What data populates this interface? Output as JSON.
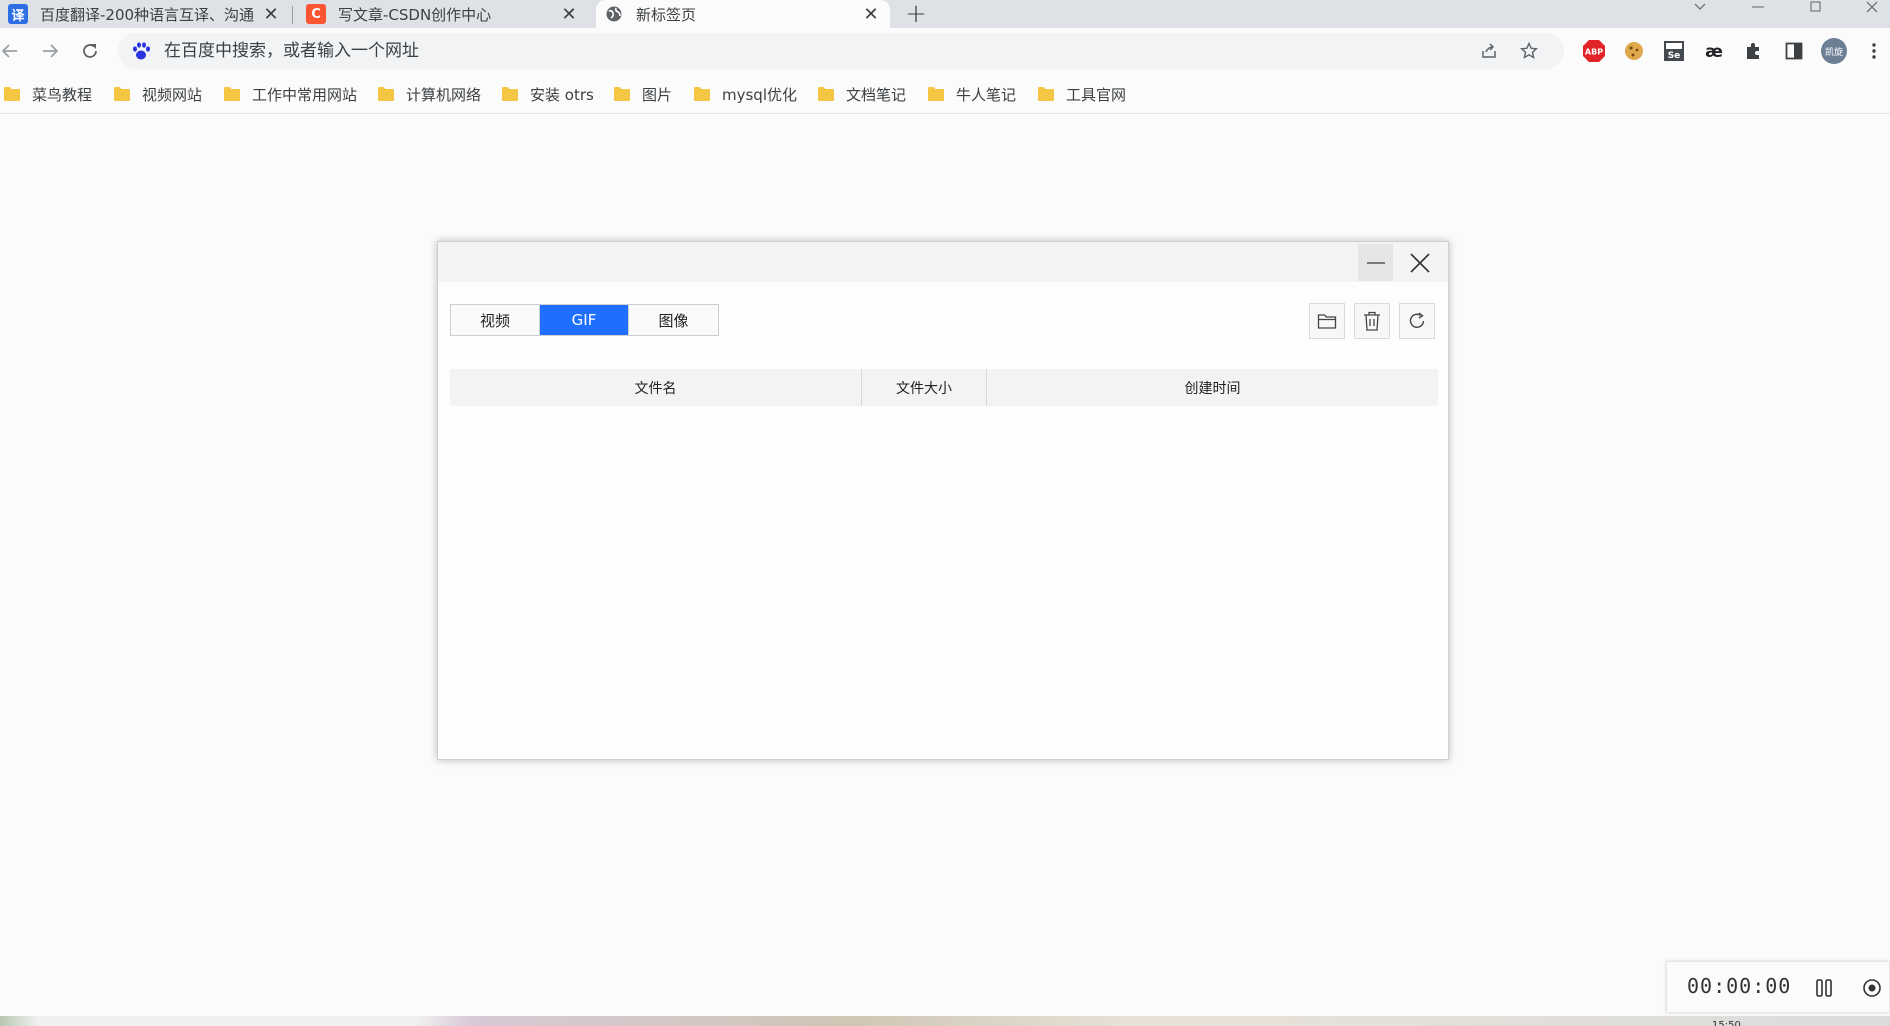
{
  "browser": {
    "tabs": [
      {
        "title": "百度翻译-200种语言互译、沟通",
        "favicon_text": "译",
        "favicon_color": "#2d6ee6",
        "active": false
      },
      {
        "title": "写文章-CSDN创作中心",
        "favicon_text": "C",
        "favicon_color": "#fc5531",
        "active": false
      },
      {
        "title": "新标签页",
        "favicon_text": "",
        "favicon_color": "#5f6368",
        "active": true
      }
    ],
    "new_tab_label": "+",
    "close_glyph": "✕",
    "omnibox_placeholder": "在百度中搜索，或者输入一个网址",
    "profile_label": "凯旋",
    "extensions": [
      "adblock-plus",
      "cookie",
      "selenium",
      "ae",
      "puzzle",
      "sidepanel"
    ],
    "abp_label": "ABP",
    "se_label": "Se",
    "ae_label": "æ"
  },
  "bookmarks": [
    {
      "label": "菜鸟教程"
    },
    {
      "label": "视频网站"
    },
    {
      "label": "工作中常用网站"
    },
    {
      "label": "计算机网络"
    },
    {
      "label": "安装 otrs"
    },
    {
      "label": "图片"
    },
    {
      "label": "mysql优化"
    },
    {
      "label": "文档笔记"
    },
    {
      "label": "牛人笔记"
    },
    {
      "label": "工具官网"
    }
  ],
  "dialog": {
    "tabs": [
      {
        "label": "视频",
        "active": false
      },
      {
        "label": "GIF",
        "active": true
      },
      {
        "label": "图像",
        "active": false
      }
    ],
    "accent_color": "#1e6fff",
    "table": {
      "columns": [
        "文件名",
        "文件大小",
        "创建时间"
      ],
      "rows": []
    }
  },
  "recorder": {
    "time": "00:00:00"
  },
  "taskbar": {
    "clock_partial": "15:50"
  }
}
